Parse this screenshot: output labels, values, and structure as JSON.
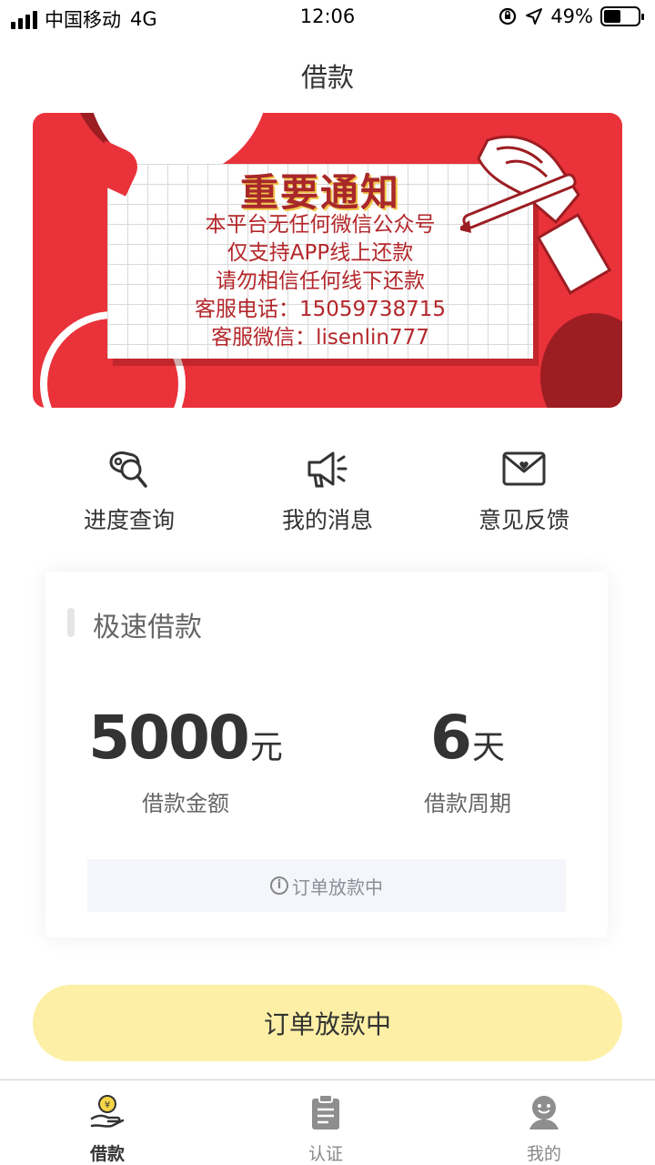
{
  "status_bar": {
    "carrier": "中国移动",
    "network": "4G",
    "time": "12:06",
    "battery": "49%",
    "battery_level": 0.49
  },
  "nav": {
    "title": "借款"
  },
  "banner": {
    "title": "重要通知",
    "lines": [
      "本平台无任何微信公众号",
      "仅支持APP线上还款",
      "请勿相信任何线下还款",
      "客服电话：15059738715",
      "客服微信：lisenlin777"
    ]
  },
  "quick_actions": [
    {
      "label": "进度查询",
      "icon": "progress-search-icon"
    },
    {
      "label": "我的消息",
      "icon": "megaphone-icon"
    },
    {
      "label": "意见反馈",
      "icon": "envelope-heart-icon"
    }
  ],
  "loan_card": {
    "title": "极速借款",
    "amount": "5000",
    "amount_unit": "元",
    "amount_label": "借款金额",
    "period": "6",
    "period_unit": "天",
    "period_label": "借款周期",
    "status": "订单放款中"
  },
  "main_button": {
    "label": "订单放款中"
  },
  "tabbar": [
    {
      "label": "借款",
      "icon": "coin-hand-icon",
      "active": true
    },
    {
      "label": "认证",
      "icon": "clipboard-icon",
      "active": false
    },
    {
      "label": "我的",
      "icon": "user-face-icon",
      "active": false
    }
  ],
  "colors": {
    "banner_red": "#e9323a",
    "button_yellow": "#fdf0a6",
    "accent_yellow": "#f5d547"
  }
}
